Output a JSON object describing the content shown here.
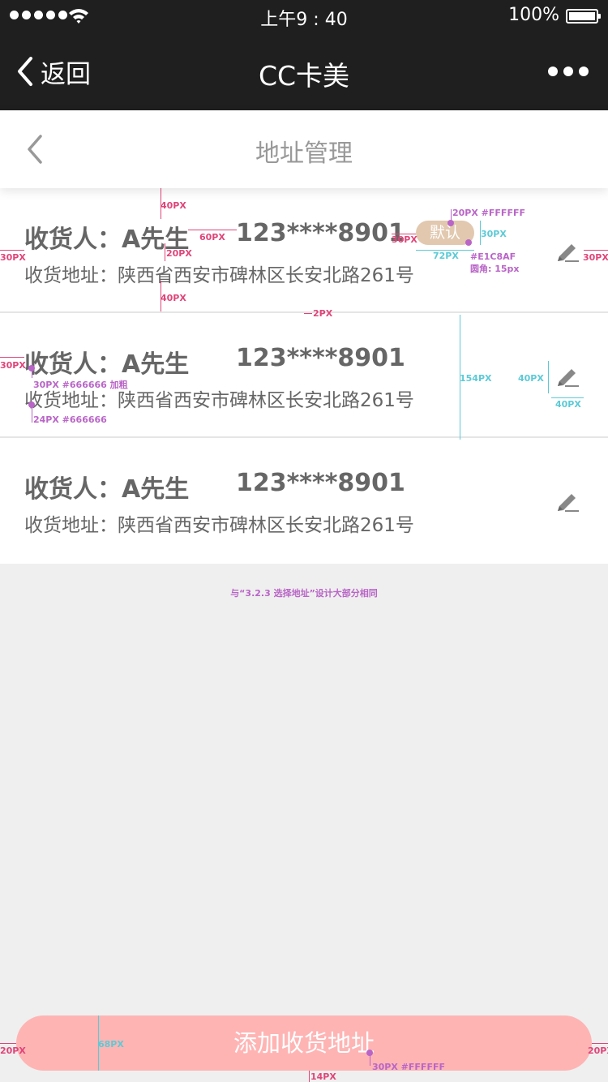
{
  "status_bar": {
    "time": "上午9 : 40",
    "battery": "100%"
  },
  "nav": {
    "back_label": "返回",
    "title": "CC卡美"
  },
  "page": {
    "title": "地址管理"
  },
  "addresses": [
    {
      "name": "收货人：A先生",
      "phone": "123****8901",
      "address": "收货地址：陕西省西安市碑林区长安北路261号",
      "default_label": "默认"
    },
    {
      "name": "收货人：A先生",
      "phone": "123****8901",
      "address": "收货地址：陕西省西安市碑林区长安北路261号"
    },
    {
      "name": "收货人：A先生",
      "phone": "123****8901",
      "address": "收货地址：陕西省西安市碑林区长安北路261号"
    }
  ],
  "annotations": {
    "a_40px_top": "40PX",
    "a_20px_gap": "20PX",
    "a_40px_bottom": "40PX",
    "a_60px": "60PX",
    "a_30px_badge_gap": "30PX",
    "a_20px_fff": "20PX #FFFFFF",
    "a_30px_badge_h": "30PX",
    "a_72px": "72PX",
    "a_badge_color": "#E1C8AF",
    "a_radius": "圆角: 15px",
    "a_30px_left": "30PX",
    "a_30px_right": "30PX",
    "a_2px": "2PX",
    "a_30px_left2": "30PX",
    "a_name_spec": "30PX #666666 加粗",
    "a_addr_spec": "24PX #666666",
    "a_154px": "154PX",
    "a_40px_icon_h": "40PX",
    "a_40px_icon_w": "40PX",
    "a_20px_btn_left": "20PX",
    "a_68px": "68PX",
    "a_btn_text": "30PX #FFFFFF",
    "a_20px_btn_right": "20PX",
    "a_14px": "14PX"
  },
  "note": "与“3.2.3 选择地址”设计大部分相同",
  "add_button": "添加收货地址",
  "colors": {
    "nav_bg": "#1f1f1f",
    "badge": "#E1C8AF",
    "add_button": "#ffb4b4",
    "text": "#666666"
  }
}
